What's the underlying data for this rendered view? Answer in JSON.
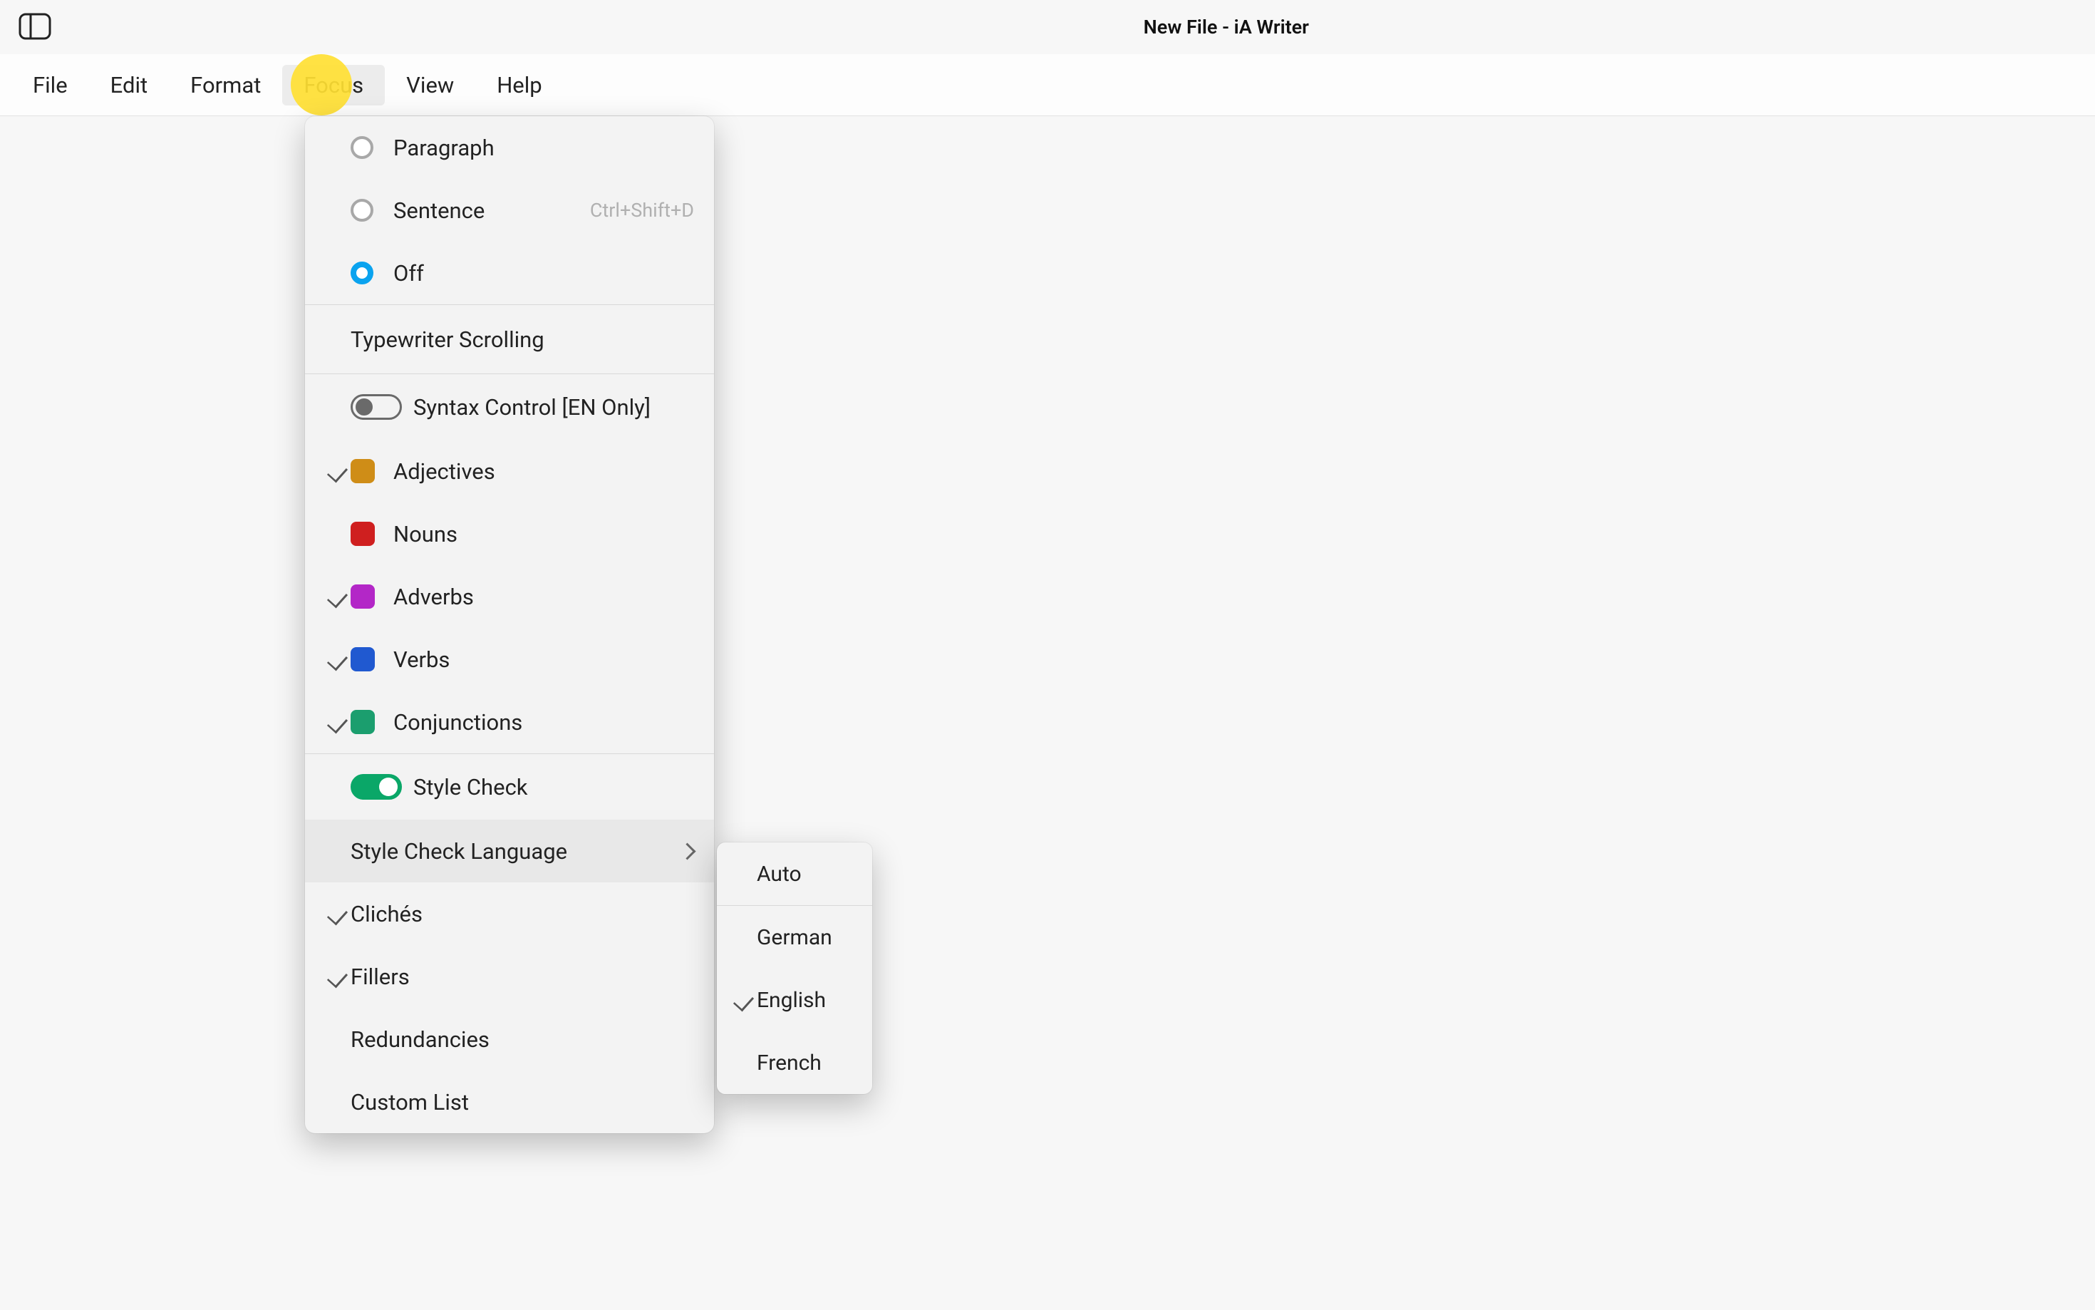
{
  "window": {
    "title": "New File - iA Writer"
  },
  "menubar": {
    "items": [
      {
        "id": "file",
        "label": "File"
      },
      {
        "id": "edit",
        "label": "Edit"
      },
      {
        "id": "format",
        "label": "Format"
      },
      {
        "id": "focus",
        "label": "Focus",
        "active": true
      },
      {
        "id": "view",
        "label": "View"
      },
      {
        "id": "help",
        "label": "Help"
      }
    ]
  },
  "focus_menu": {
    "focus_mode": {
      "selected": "off",
      "options": [
        {
          "id": "paragraph",
          "label": "Paragraph",
          "accel": ""
        },
        {
          "id": "sentence",
          "label": "Sentence",
          "accel": "Ctrl+Shift+D"
        },
        {
          "id": "off",
          "label": "Off",
          "accel": ""
        }
      ]
    },
    "typewriter_scrolling": {
      "label": "Typewriter Scrolling"
    },
    "syntax_control": {
      "label": "Syntax Control [EN Only]",
      "enabled": false,
      "parts": [
        {
          "id": "adjectives",
          "label": "Adjectives",
          "checked": true,
          "color": "#cf8d17"
        },
        {
          "id": "nouns",
          "label": "Nouns",
          "checked": false,
          "color": "#cf1f1f"
        },
        {
          "id": "adverbs",
          "label": "Adverbs",
          "checked": true,
          "color": "#b327c7"
        },
        {
          "id": "verbs",
          "label": "Verbs",
          "checked": true,
          "color": "#2059d0"
        },
        {
          "id": "conjunctions",
          "label": "Conjunctions",
          "checked": true,
          "color": "#1b9e6e"
        }
      ]
    },
    "style_check": {
      "label": "Style Check",
      "enabled": true
    },
    "style_check_language": {
      "label": "Style Check Language",
      "options": [
        {
          "id": "auto",
          "label": "Auto",
          "checked": false
        },
        {
          "id": "german",
          "label": "German",
          "checked": false
        },
        {
          "id": "english",
          "label": "English",
          "checked": true
        },
        {
          "id": "french",
          "label": "French",
          "checked": false
        }
      ]
    },
    "style_items": [
      {
        "id": "cliches",
        "label": "Clichés",
        "checked": true
      },
      {
        "id": "fillers",
        "label": "Fillers",
        "checked": true
      },
      {
        "id": "redundancies",
        "label": "Redundancies",
        "checked": false
      },
      {
        "id": "custom_list",
        "label": "Custom List",
        "checked": false
      }
    ]
  }
}
